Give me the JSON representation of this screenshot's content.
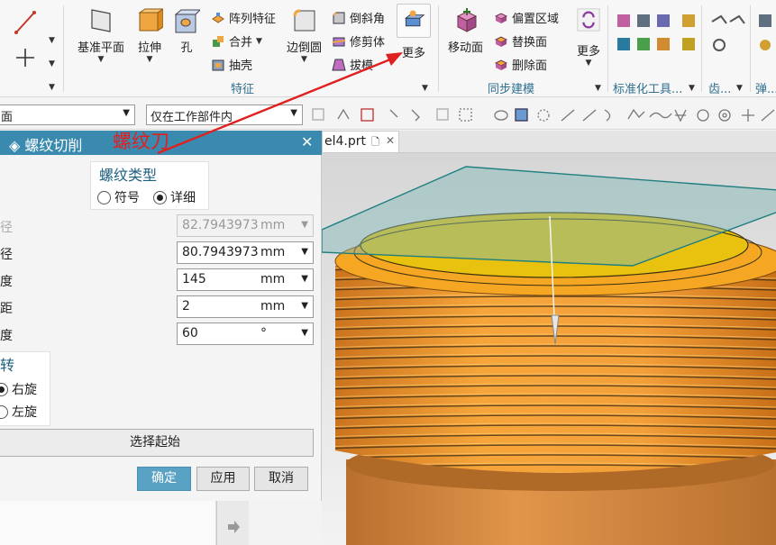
{
  "ribbon": {
    "groups": {
      "feature": "特征",
      "sync": "同步建模",
      "standard": "标准化工具...",
      "gear": "齿...",
      "spring": "弹..."
    },
    "buttons": {
      "datum_plane": "基准平面",
      "extrude": "拉伸",
      "hole": "孔",
      "pattern_feature": "阵列特征",
      "unite": "合并",
      "shell": "抽壳",
      "edge_blend": "边倒圆",
      "chamfer": "倒斜角",
      "trim_body": "修剪体",
      "draft": "拔模",
      "more_feature": "更多",
      "move_face": "移动面",
      "offset_region": "偏置区域",
      "replace_face": "替换面",
      "delete_face": "删除面",
      "more_sync": "更多"
    }
  },
  "selection_bar": {
    "type_filter": "面",
    "scope": "仅在工作部件内"
  },
  "annotation": "螺纹刀",
  "dialog": {
    "title": "螺纹切削",
    "thread_type": {
      "title": "螺纹类型",
      "options": [
        "符号",
        "详细"
      ],
      "selected": "详细"
    },
    "fields": [
      {
        "label": "大径",
        "value": "82.7943973",
        "unit": "mm",
        "disabled": true
      },
      {
        "label": "小径",
        "value": "80.7943973",
        "unit": "mm",
        "disabled": false
      },
      {
        "label": "长度",
        "value": "145",
        "unit": "mm",
        "disabled": false
      },
      {
        "label": "螺距",
        "value": "2",
        "unit": "mm",
        "disabled": false
      },
      {
        "label": "角度",
        "value": "60",
        "unit": "°",
        "disabled": false
      }
    ],
    "rotation": {
      "title": "旋转",
      "options": [
        "右旋",
        "左旋"
      ],
      "selected": "右旋"
    },
    "select_start": "选择起始",
    "ok": "确定",
    "apply": "应用",
    "cancel": "取消"
  },
  "tab": {
    "label": "el4.prt"
  },
  "colors": {
    "title_bar": "#3a8ab0",
    "thread_orange": "#f5a623",
    "top_face_yellow": "#e8c20e",
    "datum_plane": "#7fb8b8",
    "annotation_red": "#e02020"
  }
}
